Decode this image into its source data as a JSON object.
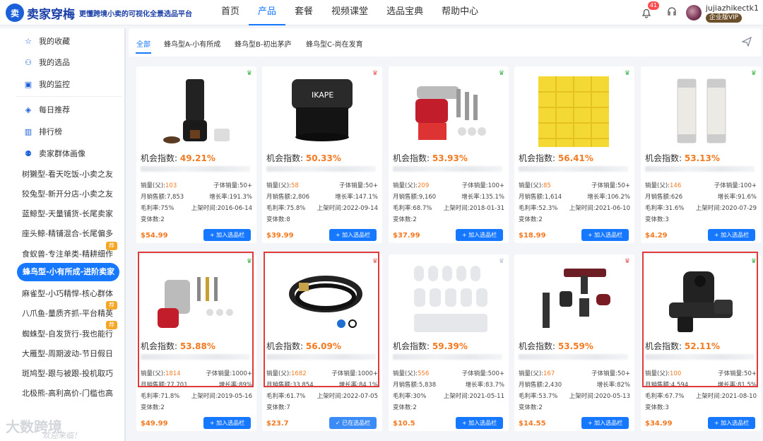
{
  "header": {
    "logo_text": "卖家穿梅",
    "logo_mark": "卖",
    "slogan": "更懂跨境小卖的可视化全景选品平台",
    "nav": [
      "首页",
      "产品",
      "套餐",
      "视频课堂",
      "选品宝典",
      "帮助中心"
    ],
    "active_nav": "产品",
    "notification_count": "41",
    "username": "jujiazhikectk1",
    "vip": "企业版VIP"
  },
  "sidebar": {
    "top_items": [
      {
        "label": "我的收藏",
        "icon": "star-icon"
      },
      {
        "label": "我的选品",
        "icon": "user-box-icon"
      },
      {
        "label": "我的监控",
        "icon": "monitor-icon"
      }
    ],
    "mid_items": [
      {
        "label": "每日推荐",
        "icon": "calendar-icon"
      },
      {
        "label": "排行榜",
        "icon": "bar-chart-icon"
      },
      {
        "label": "卖家群体画像",
        "icon": "users-icon"
      }
    ],
    "groups": [
      {
        "label": "树獭型-看天吃饭-小卖之友"
      },
      {
        "label": "狡兔型-新开分店-小卖之友"
      },
      {
        "label": "蓝鲸型-天量铺货-长尾卖家"
      },
      {
        "label": "座头鲸-精铺混合-长尾偏多"
      },
      {
        "label": "食蚁兽-专注单类-精耕细作",
        "tag": "荐"
      },
      {
        "label": "蜂鸟型-小有所成-进阶卖家",
        "active": true
      },
      {
        "label": "麻雀型-小巧精悍-核心群体"
      },
      {
        "label": "八爪鱼-量质齐抓-平台精英",
        "tag": "荐"
      },
      {
        "label": "蜘蛛型-自发货行-我也能行",
        "tag": "荐"
      },
      {
        "label": "大雁型-周期波动-节日假日"
      },
      {
        "label": "斑鸠型-跟与被跟-投机取巧"
      },
      {
        "label": "北极熊-高利高价-门槛也高"
      }
    ],
    "watermark": "大数跨境",
    "watermark_sub": "欢迎来临！"
  },
  "tabs": [
    "全部",
    "蜂鸟型A-小有所成",
    "蜂鸟型B-初出茅庐",
    "蜂鸟型C-尚在发育"
  ],
  "labels": {
    "index": "机会指数:",
    "sales_parent": "销量(父):",
    "sales_child": "子体销量:",
    "monthly_revenue": "月销售额:",
    "growth": "增长率:",
    "margin": "毛利率:",
    "listed": "上架时间:",
    "variants": "变体数:",
    "add": "加入选品栏",
    "added": "已在选品栏"
  },
  "products": [
    {
      "index": "49.21%",
      "sales": "103",
      "child": "50+",
      "revenue": "7,853",
      "growth": "191.3%",
      "margin": "75%",
      "listed": "2016-06-14",
      "variants": "2",
      "price": "$54.99",
      "crown": "green",
      "added": false,
      "image": "coffee-maker"
    },
    {
      "index": "50.33%",
      "sales": "58",
      "child": "50+",
      "revenue": "2,806",
      "growth": "147.1%",
      "margin": "75.8%",
      "listed": "2022-09-14",
      "variants": "8",
      "price": "$39.99",
      "crown": "red",
      "added": false,
      "image": "coffee-tamper"
    },
    {
      "index": "53.93%",
      "sales": "209",
      "child": "100+",
      "revenue": "9,160",
      "growth": "135.1%",
      "margin": "68.7%",
      "listed": "2018-01-31",
      "variants": "2",
      "price": "$37.99",
      "crown": "green",
      "added": false,
      "image": "meat-grinder"
    },
    {
      "index": "56.41%",
      "sales": "85",
      "child": "50+",
      "revenue": "1,614",
      "growth": "106.2%",
      "margin": "52.3%",
      "listed": "2021-06-10",
      "variants": "2",
      "price": "$18.99",
      "crown": "green",
      "added": false,
      "image": "yellow-bags"
    },
    {
      "index": "53.13%",
      "sales": "146",
      "child": "100+",
      "revenue": "626",
      "growth": "91.6%",
      "margin": "31.6%",
      "listed": "2020-07-29",
      "variants": "3",
      "price": "$4.29",
      "crown": "green",
      "added": false,
      "image": "fuses"
    },
    {
      "index": "53.88%",
      "sales": "1814",
      "child": "1000+",
      "revenue": "77,701",
      "growth": "89%",
      "margin": "71.8%",
      "listed": "2019-05-16",
      "variants": "2",
      "price": "$49.99",
      "crown": "green",
      "added": false,
      "image": "meat-grinder-attachment",
      "highlight": true
    },
    {
      "index": "56.09%",
      "sales": "1682",
      "child": "1000+",
      "revenue": "33,854",
      "growth": "84.1%",
      "margin": "61.7%",
      "listed": "2022-07-05",
      "variants": "7",
      "price": "$23.7",
      "crown": "red",
      "added": true,
      "image": "hose",
      "highlight": true
    },
    {
      "index": "59.39%",
      "sales": "556",
      "child": "500+",
      "revenue": "5,838",
      "growth": "83.7%",
      "margin": "30%",
      "listed": "2021-05-11",
      "variants": "2",
      "price": "$10.5",
      "crown": "white",
      "added": false,
      "image": "white-pads"
    },
    {
      "index": "53.59%",
      "sales": "167",
      "child": "50+",
      "revenue": "2,430",
      "growth": "82%",
      "margin": "53.7%",
      "listed": "2020-05-13",
      "variants": "2",
      "price": "$14.55",
      "crown": "red",
      "added": false,
      "image": "vacuum-tools"
    },
    {
      "index": "52.11%",
      "sales": "100",
      "child": "50+",
      "revenue": "4,594",
      "growth": "81.5%",
      "margin": "67.7%",
      "listed": "2021-08-10",
      "variants": "3",
      "price": "$34.99",
      "crown": "green",
      "added": false,
      "image": "juicer",
      "highlight": true
    }
  ],
  "colors": {
    "accent": "#1677ff",
    "price": "#f47a20",
    "highlight": "#e03a3a",
    "crown_green": "#3cb34a",
    "crown_red": "#e85a5a"
  }
}
